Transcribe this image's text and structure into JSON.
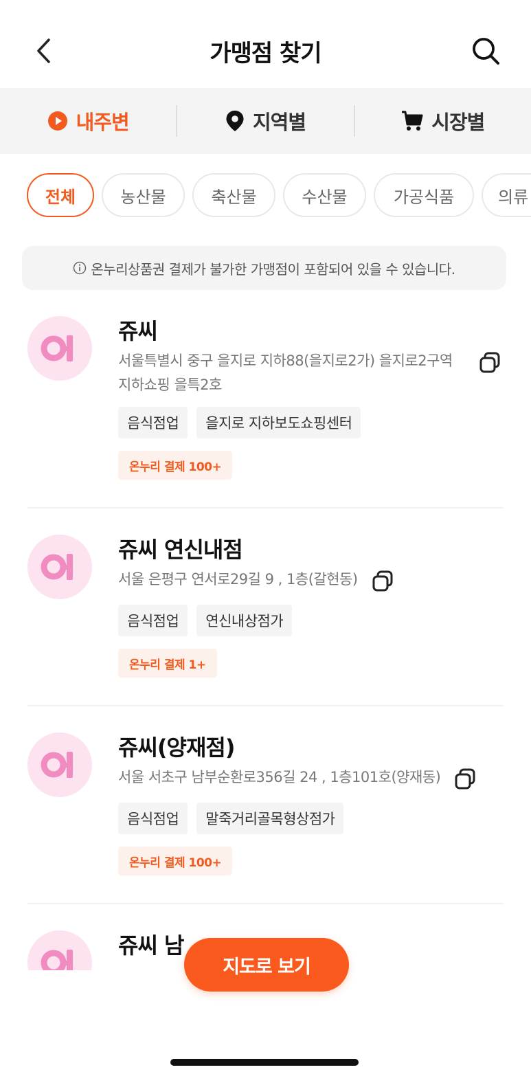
{
  "header": {
    "title": "가맹점 찾기",
    "back_icon": "chevron-left-icon",
    "search_icon": "search-icon"
  },
  "segments": [
    {
      "label": "내주변",
      "icon": "play-circle-icon",
      "active": true
    },
    {
      "label": "지역별",
      "icon": "map-pin-icon",
      "active": false
    },
    {
      "label": "시장별",
      "icon": "cart-icon",
      "active": false
    }
  ],
  "categories": [
    "전체",
    "농산물",
    "축산물",
    "수산물",
    "가공식품",
    "의류"
  ],
  "notice": {
    "icon": "info-icon",
    "text": "온누리상품권 결제가 불가한 가맹점이 포함되어 있을 수 있습니다."
  },
  "stores": [
    {
      "name": "쥬씨",
      "address": "서울특별시 중구 을지로 지하88(을지로2가) 을지로2구역지하쇼핑 을특2호",
      "tags": [
        "음식점업",
        "을지로 지하보도쇼핑센터"
      ],
      "payment": "온누리 결제 100+"
    },
    {
      "name": "쥬씨 연신내점",
      "address": "서울 은평구 연서로29길 9 , 1층(갈현동)",
      "tags": [
        "음식점업",
        "연신내상점가"
      ],
      "payment": "온누리 결제 1+"
    },
    {
      "name": "쥬씨(양재점)",
      "address": "서울 서초구 남부순환로356길 24 , 1층101호(양재동)",
      "tags": [
        "음식점업",
        "말죽거리골목형상점가"
      ],
      "payment": "온누리 결제 100+"
    },
    {
      "name": "쥬씨 남",
      "address": "",
      "tags": [],
      "payment": ""
    }
  ],
  "map_button": "지도로 보기",
  "colors": {
    "accent": "#f25a1f",
    "map_button": "#fb5a1e",
    "avatar_bg": "#fde2ef",
    "avatar_fg": "#f08cc0"
  }
}
